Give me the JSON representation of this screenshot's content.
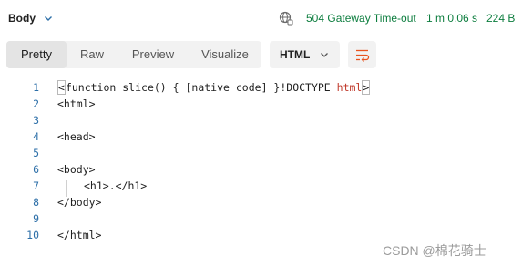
{
  "header": {
    "body_label": "Body",
    "status": "504 Gateway Time-out",
    "time": "1 m 0.06 s",
    "size": "224 B",
    "status_color": "#0c7d3e"
  },
  "view_tabs": {
    "items": [
      {
        "label": "Pretty",
        "active": true
      },
      {
        "label": "Raw",
        "active": false
      },
      {
        "label": "Preview",
        "active": false
      },
      {
        "label": "Visualize",
        "active": false
      }
    ]
  },
  "format_select": {
    "value": "HTML"
  },
  "wrap_button": {
    "icon": "wrap-lines-icon",
    "color": "#e8531f"
  },
  "editor": {
    "lines": [
      {
        "num": "1",
        "pre": "<!DOCTYPE ",
        "tag": "html",
        "post": ">"
      },
      {
        "num": "2",
        "text": "<html>"
      },
      {
        "num": "3",
        "text": ""
      },
      {
        "num": "4",
        "text": "<head>"
      },
      {
        "num": "5",
        "text": ""
      },
      {
        "num": "6",
        "text": "<body>"
      },
      {
        "num": "7",
        "text": "<h1>.</h1>"
      },
      {
        "num": "8",
        "text": "</body>"
      },
      {
        "num": "9",
        "text": ""
      },
      {
        "num": "10",
        "text": "</html>"
      }
    ]
  },
  "watermark": "CSDN @棉花骑士"
}
